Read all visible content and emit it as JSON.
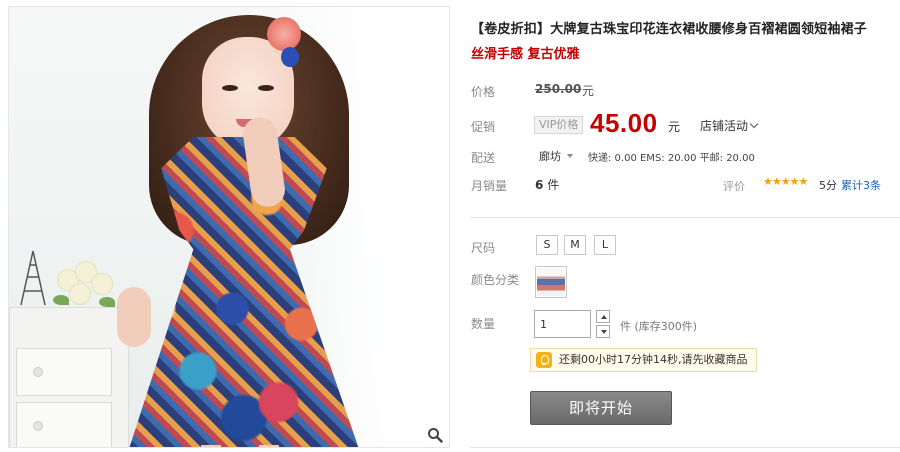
{
  "product": {
    "title": "【卷皮折扣】大牌复古珠宝印花连衣裙收腰修身百褶裙圆领短袖裙子",
    "subtitle": "丝滑手感 复古优雅"
  },
  "price": {
    "label": "价格",
    "original": "250.00",
    "unit": "元"
  },
  "promo": {
    "label": "促销",
    "badge": "VIP价格",
    "price": "45.00",
    "unit": "元",
    "store_activity": "店铺活动"
  },
  "shipping": {
    "label": "配送",
    "location": "廊坊",
    "fees": "快递: 0.00 EMS: 20.00 平邮: 20.00"
  },
  "sales": {
    "label": "月销量",
    "count": "6",
    "unit": "件",
    "rating_label": "评价",
    "stars": "★★★★★",
    "score": "5分",
    "cumulative": "累计3条"
  },
  "options": {
    "size_label": "尺码",
    "sizes": [
      "S",
      "M",
      "L"
    ],
    "color_label": "颜色分类",
    "quantity_label": "数量",
    "quantity_value": "1",
    "stock_text": "件 (库存300件)"
  },
  "notice": {
    "text": "还剩00小时17分钟14秒,请先收藏商品"
  },
  "action": {
    "start_label": "即将开始"
  },
  "icons": {
    "zoom": "magnifier-icon",
    "bulb": "lightbulb-icon"
  },
  "colors": {
    "price_red": "#c40000",
    "link_blue": "#1a64c4",
    "star_orange": "#f0a30a"
  }
}
